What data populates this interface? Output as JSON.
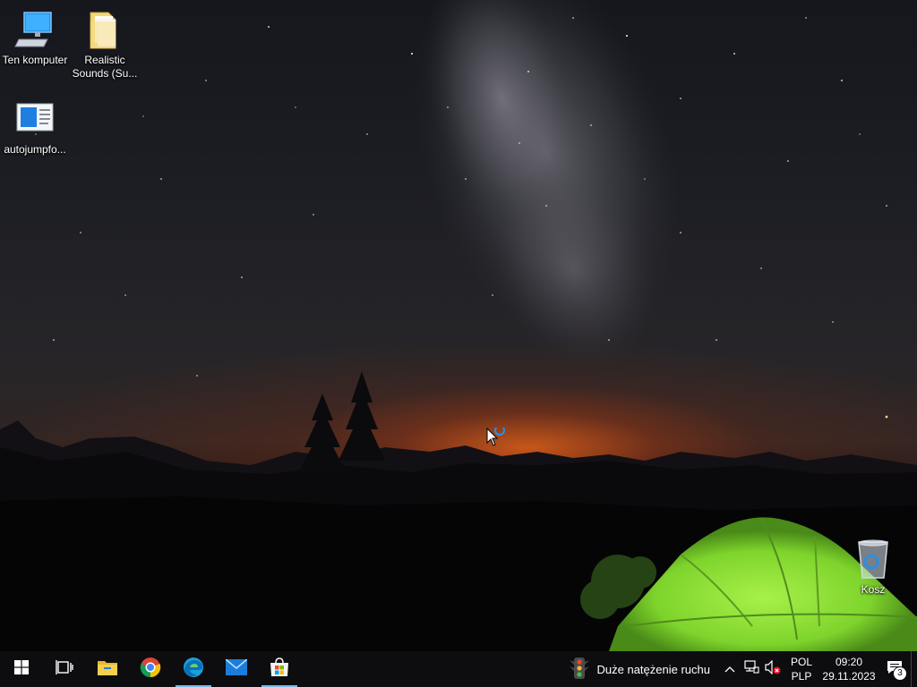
{
  "desktop": {
    "icons": [
      {
        "label": "Ten komputer",
        "icon": "this-pc-icon"
      },
      {
        "label": "Realistic Sounds (Su...",
        "icon": "folder-icon"
      },
      {
        "label": "autojumpfo...",
        "icon": "document-icon"
      },
      {
        "label": "Kosz",
        "icon": "recycle-bin-icon"
      }
    ]
  },
  "taskbar": {
    "pinned": [
      {
        "name": "start",
        "icon": "windows-start-icon"
      },
      {
        "name": "task-view",
        "icon": "task-view-icon"
      },
      {
        "name": "file-explorer",
        "icon": "file-explorer-icon"
      },
      {
        "name": "chrome",
        "icon": "chrome-icon"
      },
      {
        "name": "edge",
        "icon": "edge-icon"
      },
      {
        "name": "mail",
        "icon": "mail-icon"
      },
      {
        "name": "store",
        "icon": "store-icon"
      }
    ],
    "weather": {
      "text": "Duże natężenie ruchu",
      "icon": "traffic-light-icon"
    },
    "tray": {
      "chevron": "chevron-up-icon",
      "network": "network-icon",
      "volume": "volume-muted-icon",
      "lang_top": "POL",
      "lang_bottom": "PLP",
      "time": "09:20",
      "date": "29.11.2023",
      "notifications_count": "3"
    }
  },
  "colors": {
    "taskbar": "#0d0d0f",
    "active_indicator": "#76b9ed",
    "tent_green": "#8ee83a",
    "sunset_orange": "#dc5f19"
  }
}
